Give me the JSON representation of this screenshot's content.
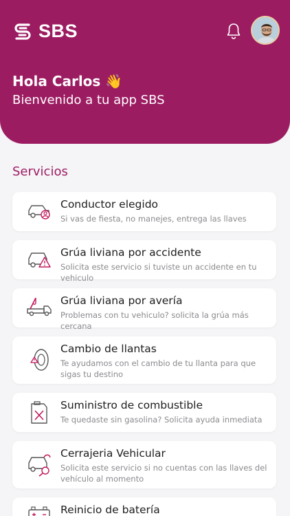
{
  "app": {
    "brand": "SBS",
    "brand_color": "#9c1c62"
  },
  "header": {
    "greeting": "Hola Carlos 👋",
    "welcome": "Bienvenido a tu app SBS"
  },
  "icons": {
    "bell": "bell-icon",
    "avatar": "user-avatar"
  },
  "services": {
    "title": "Servicios",
    "items": [
      {
        "title": "Conductor elegido",
        "desc": "Si vas de fiesta, no manejes, entrega las llaves",
        "icon": "car-driver-icon"
      },
      {
        "title": "Grúa liviana por accidente",
        "desc": "Solicita este servicio si tuviste un accidente en tu vehiculo",
        "icon": "car-warning-icon"
      },
      {
        "title": "Grúa liviana por avería",
        "desc": "Problemas con tu vehiculo? solicita la grúa más cercana",
        "icon": "tow-truck-icon"
      },
      {
        "title": "Cambio de llantas",
        "desc": "Te ayudamos con el cambio de tu llanta para que sigas tu destino",
        "icon": "tire-icon"
      },
      {
        "title": "Suministro de combustible",
        "desc": "Te quedaste sin gasolina? Solicita ayuda inmediata",
        "icon": "fuel-can-icon"
      },
      {
        "title": "Cerrajeria Vehicular",
        "desc": "Solicita este servicio si no cuentas con las llaves del vehículo al momento",
        "icon": "car-key-icon"
      },
      {
        "title": "Reinicio de batería",
        "desc": "",
        "icon": "battery-icon"
      }
    ]
  }
}
